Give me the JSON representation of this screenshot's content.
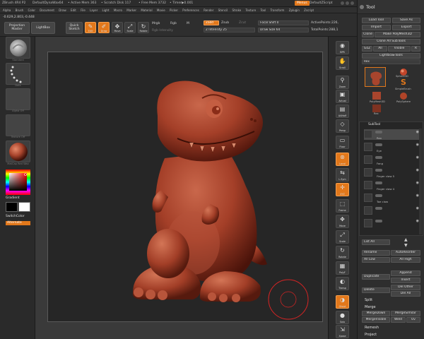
{
  "titlebar": {
    "app": "ZBrush 4R4 P2",
    "doc": "DefaultDynaWax64",
    "active_mem": "• Active Mem 363",
    "scratch": "• Scratch Disk 117",
    "free_mem": "• Free Mem 3732",
    "timer": "• Timer▶0.001",
    "menus": "Menus",
    "script": "DefaultZScript"
  },
  "menubar": [
    "Alpha",
    "Brush",
    "Color",
    "Document",
    "Draw",
    "Edit",
    "File",
    "Layer",
    "Light",
    "Macro",
    "Marker",
    "Material",
    "Movie",
    "Picker",
    "Preferences",
    "Render",
    "Stencil",
    "Stroke",
    "Texture",
    "Tool",
    "Transform",
    "Zplugin",
    "Zscript"
  ],
  "shelf": {
    "coords": "-0.629,2.803,-0.448",
    "projection_master": "Projection\nMaster",
    "lightbox": "LightBox",
    "quick_sketch": "Quick\nSketch",
    "edit": "Edit",
    "draw": "Draw",
    "move": "Move",
    "scale": "Scale",
    "rotate": "Rotate",
    "mrgb": "Mrgb",
    "rgb": "Rgb",
    "m": "M",
    "rgb_intensity": "Rgb Intensity",
    "zadd": "Zadd",
    "zsub": "Zsub",
    "zcut": "Zcut",
    "z_intensity": "Z Intensity 25",
    "z_intensity_level": 0.25,
    "focal_shift": "Focal Shift 0",
    "draw_size": "Draw Size 64",
    "active_points": "ActivePoints:226,",
    "total_points": "TotalPoints:288,1"
  },
  "leftshelf": {
    "standard": "Standard",
    "dots": "Dots",
    "alpha_off": "Alpha Off",
    "texture_off": "Texture Off",
    "material": "MatCap Red Wax",
    "gradient": "Gradient",
    "switch_color": "SwitchColor",
    "alternate": "Alternate"
  },
  "rightbar": [
    {
      "icon": "bpr-icon",
      "label": "BPR",
      "on": false
    },
    {
      "icon": "scroll-icon",
      "label": "Scroll",
      "on": false
    },
    {
      "icon": "zoom-icon",
      "label": "Zoom",
      "on": false
    },
    {
      "icon": "actual-icon",
      "label": "Actual",
      "on": false
    },
    {
      "icon": "aahalf-icon",
      "label": "AAHalf",
      "on": false
    },
    {
      "icon": "persp-icon",
      "label": "Persp",
      "on": false
    },
    {
      "icon": "floor-icon",
      "label": "Floor",
      "on": false
    },
    {
      "icon": "local-icon",
      "label": "Local",
      "on": true
    },
    {
      "icon": "lsym-icon",
      "label": "L.Sym",
      "on": false
    },
    {
      "icon": "xyz-icon",
      "label": "XYZ",
      "on": true
    },
    {
      "icon": "frame-icon",
      "label": "Frame",
      "on": false
    },
    {
      "icon": "move-icon",
      "label": "Move",
      "on": false
    },
    {
      "icon": "scale-icon",
      "label": "Scale",
      "on": false
    },
    {
      "icon": "rotate-icon",
      "label": "Rotate",
      "on": false
    },
    {
      "icon": "polyf-icon",
      "label": "PolyF",
      "on": false
    },
    {
      "icon": "transp-icon",
      "label": "Transp",
      "on": false
    },
    {
      "icon": "ghost-icon",
      "label": "Ghost",
      "on": true
    },
    {
      "icon": "solo-icon",
      "label": "Solo",
      "on": false
    },
    {
      "icon": "xpose-icon",
      "label": "Xpose",
      "on": false
    }
  ],
  "tool": {
    "title": "Tool",
    "load_tool": "Load Tool",
    "save_as": "Save As",
    "import": "Import",
    "export": "Export",
    "clone": "Clone",
    "make_polymesh": "Make PolyMesh3D",
    "clone_all": "Clone All SubTools",
    "goz": "GoZ",
    "all": "All",
    "visible": "Visible",
    "r": "R",
    "lightbox_tools": "Lightbox▸Tools",
    "rex": "Rex",
    "sphere3d": "Sphere3D",
    "simplebrush": "SimpleBrush",
    "polymesh3d": "PolyMesh3D",
    "polysphere": "PolySphere",
    "subtool": "SubTool",
    "subtools": [
      "Rex",
      "Eye",
      "Fang",
      "Finger claw 5",
      "Finger claw 4",
      "Toe claw",
      "",
      ""
    ],
    "list_all": "List All",
    "rename": "Rename",
    "autoreorder": "AutoReorder",
    "all_low": "All Low",
    "all_high": "All High",
    "duplicate": "Duplicate",
    "append": "Append",
    "insert": "Insert",
    "delete": "Delete",
    "del_other": "Del Other",
    "del_all": "Del All",
    "split": "Split",
    "merge": "Merge",
    "mergedown": "MergeDown",
    "mergesimilar": "MergeSimilar",
    "mergevisible": "MergeVisible",
    "weld": "Weld",
    "uv": "Uv",
    "remesh": "Remesh",
    "project": "Project"
  },
  "colors": {
    "accent": "#e2781b",
    "wax": "#a9452d"
  }
}
